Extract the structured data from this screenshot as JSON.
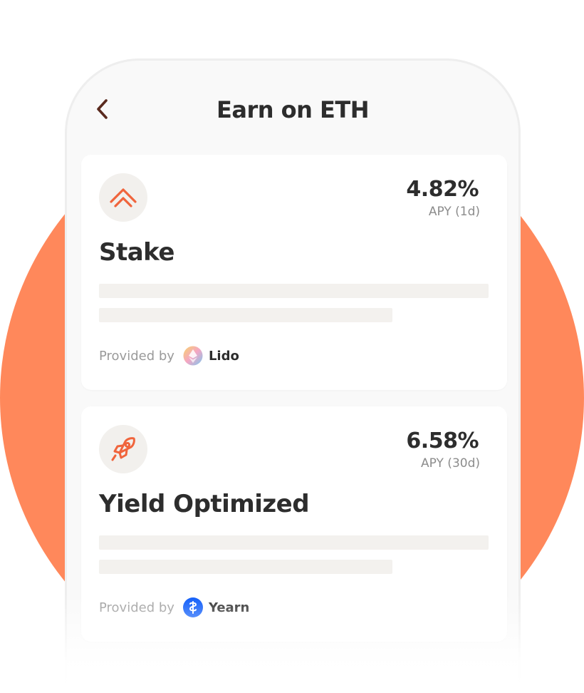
{
  "header": {
    "title": "Earn on ETH",
    "back_icon": "chevron-left-icon"
  },
  "cards": [
    {
      "icon": "double-chevron-up-icon",
      "rate": "4.82%",
      "rate_label": "APY (1d)",
      "title": "Stake",
      "provided_by_label": "Provided by",
      "provider_name": "Lido",
      "provider_icon": "lido-logo-icon"
    },
    {
      "icon": "rocket-icon",
      "rate": "6.58%",
      "rate_label": "APY (30d)",
      "title": "Yield Optimized",
      "provided_by_label": "Provided by",
      "provider_name": "Yearn",
      "provider_icon": "yearn-logo-icon"
    }
  ],
  "colors": {
    "accent": "#FF885B",
    "icon_orange": "#F0643C",
    "text_dark": "#2D2D2D",
    "text_muted": "#8C8C8C",
    "yearn_blue": "#0657F9"
  }
}
